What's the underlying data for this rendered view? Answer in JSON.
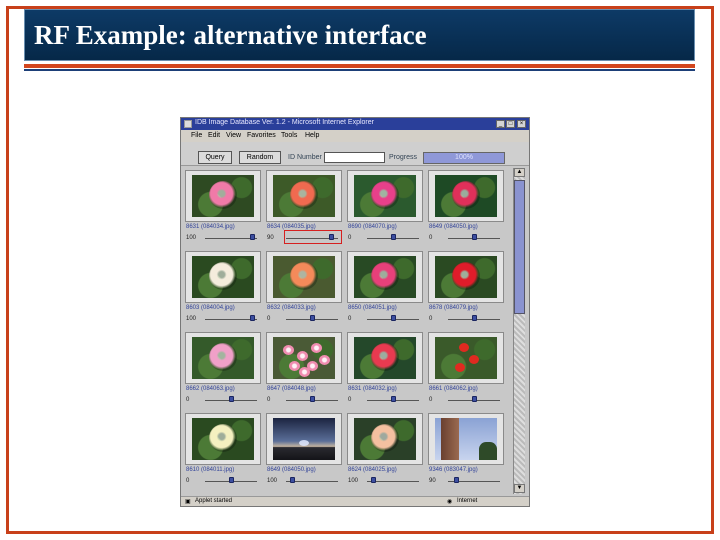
{
  "slide": {
    "title": "RF Example: alternative interface"
  },
  "window": {
    "title": "IDB Image Database Ver. 1.2 - Microsoft Internet Explorer",
    "menu": [
      "File",
      "Edit",
      "View",
      "Favorites",
      "Tools",
      "Help"
    ],
    "toolbar": {
      "query_label": "Query",
      "random_label": "Random",
      "id_label": "ID Number",
      "id_value": "",
      "progress_label": "Progress",
      "progress_value": "100%"
    },
    "status": {
      "left": "Applet started",
      "right": "Internet"
    }
  },
  "images": [
    {
      "caption": "8631 (084034.jpg)",
      "score": "100",
      "slider": 0.95,
      "kind": "rose",
      "flower": "#f07aa8",
      "bg": "#2e4a22"
    },
    {
      "caption": "8634 (084035.jpg)",
      "score": "90",
      "slider": 0.92,
      "kind": "rose",
      "flower": "#f06a50",
      "bg": "#3d5a28"
    },
    {
      "caption": "8690 (084070.jpg)",
      "score": "0",
      "slider": 0.5,
      "kind": "rose",
      "flower": "#e8408a",
      "bg": "#2b5a2e"
    },
    {
      "caption": "8649 (084050.jpg)",
      "score": "0",
      "slider": 0.5,
      "kind": "rose",
      "flower": "#e0305a",
      "bg": "#1e4a25"
    },
    {
      "caption": "8603 (084004.jpg)",
      "score": "100",
      "slider": 0.95,
      "kind": "rose",
      "flower": "#f4ecdc",
      "bg": "#2a4a20"
    },
    {
      "caption": "8632 (084033.jpg)",
      "score": "0",
      "slider": 0.5,
      "kind": "rose",
      "flower": "#f48a5a",
      "bg": "#4a5a30"
    },
    {
      "caption": "8650 (084051.jpg)",
      "score": "0",
      "slider": 0.5,
      "kind": "rose",
      "flower": "#e8407a",
      "bg": "#284a24"
    },
    {
      "caption": "8678 (084079.jpg)",
      "score": "0",
      "slider": 0.5,
      "kind": "rose",
      "flower": "#e01c2a",
      "bg": "#2a4a22"
    },
    {
      "caption": "8662 (084063.jpg)",
      "score": "0",
      "slider": 0.5,
      "kind": "rose",
      "flower": "#f0a0c8",
      "bg": "#345a2a"
    },
    {
      "caption": "8647 (084048.jpg)",
      "score": "0",
      "slider": 0.5,
      "kind": "cluster",
      "flower": "#f08cb0",
      "bg": "#4a5a36"
    },
    {
      "caption": "8631 (084032.jpg)",
      "score": "0",
      "slider": 0.5,
      "kind": "rose",
      "flower": "#e83a50",
      "bg": "#24482a"
    },
    {
      "caption": "8661 (084062.jpg)",
      "score": "0",
      "slider": 0.5,
      "kind": "stem",
      "flower": "#e02a20",
      "bg": "#3a5a2a"
    },
    {
      "caption": "8610 (084011.jpg)",
      "score": "0",
      "slider": 0.5,
      "kind": "rose",
      "flower": "#f4f0c0",
      "bg": "#2a4a20"
    },
    {
      "caption": "8649 (084050.jpg)",
      "score": "100",
      "slider": 0.08,
      "kind": "landscape",
      "flower": "#8aa8d0",
      "bg": "#2a3048"
    },
    {
      "caption": "8624 (084025.jpg)",
      "score": "100",
      "slider": 0.08,
      "kind": "rose",
      "flower": "#f4c0a0",
      "bg": "#2a4028"
    },
    {
      "caption": "9346 (083047.jpg)",
      "score": "90",
      "slider": 0.12,
      "kind": "tower",
      "flower": "#8a5a40",
      "bg": "#aab8d8"
    }
  ]
}
